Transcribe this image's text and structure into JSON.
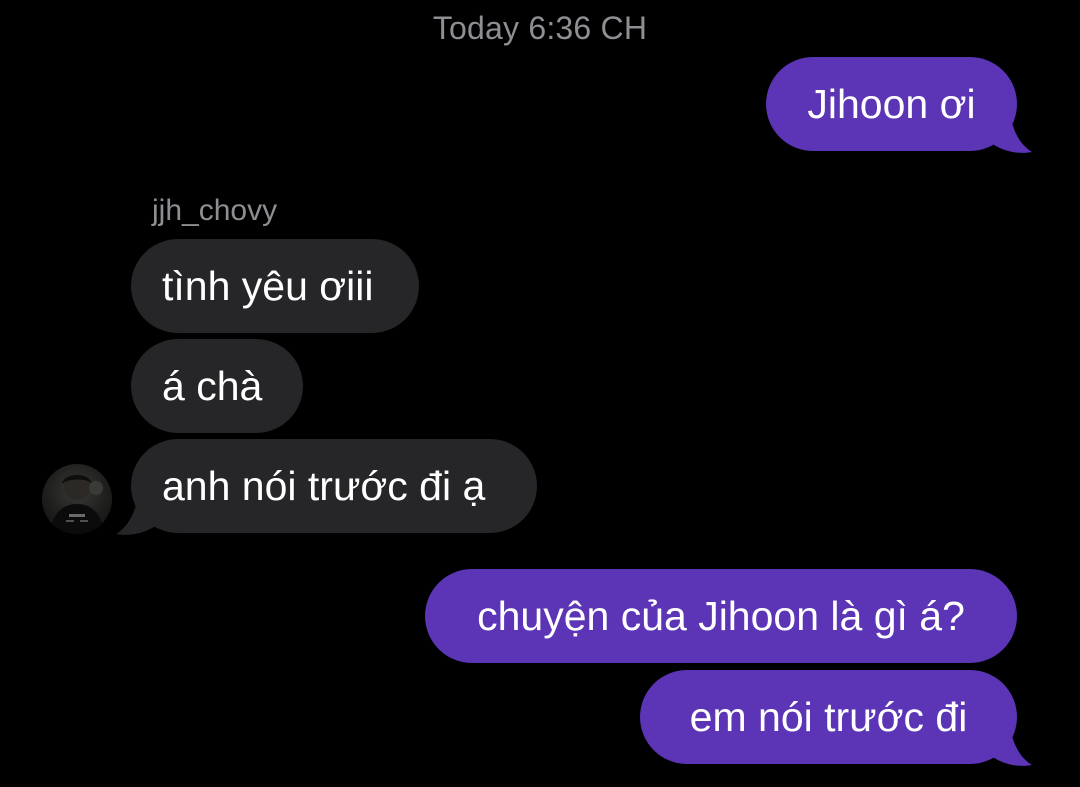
{
  "thread": {
    "timestamp": "Today 6:36 CH",
    "sender_name": "jjh_chovy"
  },
  "colors": {
    "background": "#000000",
    "outgoing_bubble": "#5b35b5",
    "incoming_bubble": "#262629",
    "meta_text": "#8e8e93"
  },
  "messages": [
    {
      "direction": "outgoing",
      "text": "Jihoon ơi"
    },
    {
      "direction": "incoming",
      "text": "tình yêu ơiii"
    },
    {
      "direction": "incoming",
      "text": "á chà"
    },
    {
      "direction": "incoming",
      "text": "anh nói trước đi ạ"
    },
    {
      "direction": "outgoing",
      "text": "chuyện của Jihoon là gì á?"
    },
    {
      "direction": "outgoing",
      "text": "em nói trước đi"
    }
  ],
  "avatar": {
    "icon": "profile-photo"
  }
}
